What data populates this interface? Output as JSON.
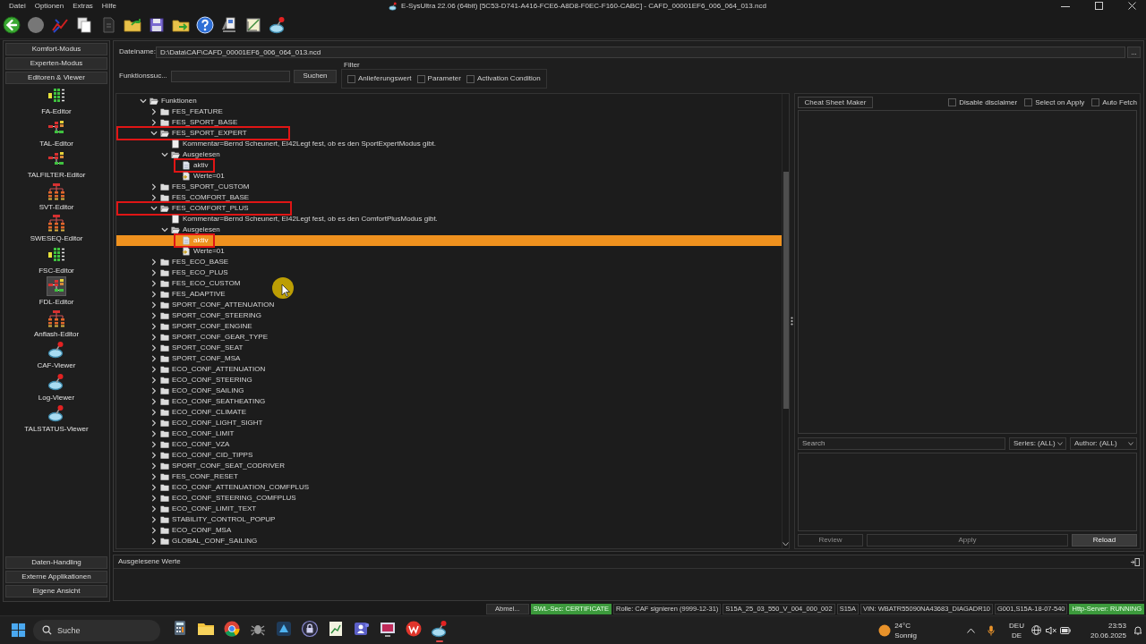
{
  "window": {
    "title": "E-SysUltra 22.06 (64bit) [5C53-D741-A416-FCE6-A8D8-F0EC-F160-CABC] - CAFD_00001EF6_006_064_013.ncd"
  },
  "menu": [
    "Datei",
    "Optionen",
    "Extras",
    "Hilfe"
  ],
  "sidebar": {
    "sections": [
      {
        "label": "Komfort-Modus"
      },
      {
        "label": "Experten-Modus"
      },
      {
        "label": "Editoren & Viewer",
        "items": [
          {
            "label": "FA-Editor",
            "kind": "list-editor",
            "selected": false
          },
          {
            "label": "TAL-Editor",
            "kind": "split-editor",
            "selected": false
          },
          {
            "label": "TALFILTER-Editor",
            "kind": "split-editor",
            "selected": false
          },
          {
            "label": "SVT-Editor",
            "kind": "tree-editor",
            "selected": false
          },
          {
            "label": "SWESEQ-Editor",
            "kind": "tree-editor",
            "selected": false
          },
          {
            "label": "FSC-Editor",
            "kind": "list-editor",
            "selected": false
          },
          {
            "label": "FDL-Editor",
            "kind": "split-editor",
            "selected": true
          },
          {
            "label": "Anflash-Editor",
            "kind": "tree-editor",
            "selected": false
          },
          {
            "label": "CAF-Viewer",
            "kind": "viewer",
            "selected": false
          },
          {
            "label": "Log-Viewer",
            "kind": "viewer",
            "selected": false
          },
          {
            "label": "TALSTATUS-Viewer",
            "kind": "viewer",
            "selected": false
          }
        ]
      },
      {
        "label": "Daten-Handling"
      },
      {
        "label": "Externe Applikationen"
      },
      {
        "label": "Eigene Ansicht"
      }
    ]
  },
  "file": {
    "label": "Dateiname:",
    "value": "D:\\Data\\CAF\\CAFD_00001EF6_006_064_013.ncd",
    "browse_button": "..."
  },
  "function_search": {
    "label": "Funktionssuc...",
    "button": "Suchen",
    "filter": {
      "title": "Filter",
      "options": [
        {
          "label": "Anlieferungswert",
          "checked": false
        },
        {
          "label": "Parameter",
          "checked": false
        },
        {
          "label": "Activation Condition",
          "checked": false
        }
      ]
    }
  },
  "tree": {
    "root": {
      "label": "Funktionen",
      "kind": "folder",
      "expanded": true,
      "highlighted": false,
      "selected": false,
      "children": [
        {
          "label": "FES_FEATURE",
          "kind": "folder",
          "expanded": false,
          "highlighted": false,
          "selected": false
        },
        {
          "label": "FES_SPORT_BASE",
          "kind": "folder",
          "expanded": false,
          "highlighted": false,
          "selected": false
        },
        {
          "label": "FES_SPORT_EXPERT",
          "kind": "folder",
          "expanded": true,
          "highlighted": true,
          "selected": false,
          "children": [
            {
              "label": "Kommentar=Bernd Scheunert, EI42Legt fest, ob es den SportExpertModus gibt.",
              "kind": "note",
              "highlighted": false,
              "selected": false
            },
            {
              "label": "Ausgelesen",
              "kind": "folder",
              "expanded": true,
              "highlighted": false,
              "selected": false,
              "children": [
                {
                  "label": "aktiv",
                  "kind": "entry",
                  "highlighted": true,
                  "selected": false
                },
                {
                  "label": "Werte=01",
                  "kind": "value",
                  "highlighted": false,
                  "selected": false
                }
              ]
            }
          ]
        },
        {
          "label": "FES_SPORT_CUSTOM",
          "kind": "folder",
          "expanded": false,
          "highlighted": false,
          "selected": false
        },
        {
          "label": "FES_COMFORT_BASE",
          "kind": "folder",
          "expanded": false,
          "highlighted": false,
          "selected": false
        },
        {
          "label": "FES_COMFORT_PLUS",
          "kind": "folder",
          "expanded": true,
          "highlighted": true,
          "selected": false,
          "children": [
            {
              "label": "Kommentar=Bernd Scheunert, EI42Legt fest, ob es den ComfortPlusModus gibt.",
              "kind": "note",
              "highlighted": false,
              "selected": false
            },
            {
              "label": "Ausgelesen",
              "kind": "folder",
              "expanded": true,
              "highlighted": false,
              "selected": false,
              "children": [
                {
                  "label": "aktiv",
                  "kind": "entry",
                  "highlighted": true,
                  "selected": true
                },
                {
                  "label": "Werte=01",
                  "kind": "value",
                  "highlighted": false,
                  "selected": false
                }
              ]
            }
          ]
        },
        {
          "label": "FES_ECO_BASE",
          "kind": "folder",
          "expanded": false,
          "highlighted": false,
          "selected": false
        },
        {
          "label": "FES_ECO_PLUS",
          "kind": "folder",
          "expanded": false,
          "highlighted": false,
          "selected": false
        },
        {
          "label": "FES_ECO_CUSTOM",
          "kind": "folder",
          "expanded": false,
          "highlighted": false,
          "selected": false
        },
        {
          "label": "FES_ADAPTIVE",
          "kind": "folder",
          "expanded": false,
          "highlighted": false,
          "selected": false
        },
        {
          "label": "SPORT_CONF_ATTENUATION",
          "kind": "folder",
          "expanded": false,
          "highlighted": false,
          "selected": false
        },
        {
          "label": "SPORT_CONF_STEERING",
          "kind": "folder",
          "expanded": false,
          "highlighted": false,
          "selected": false
        },
        {
          "label": "SPORT_CONF_ENGINE",
          "kind": "folder",
          "expanded": false,
          "highlighted": false,
          "selected": false
        },
        {
          "label": "SPORT_CONF_GEAR_TYPE",
          "kind": "folder",
          "expanded": false,
          "highlighted": false,
          "selected": false
        },
        {
          "label": "SPORT_CONF_SEAT",
          "kind": "folder",
          "expanded": false,
          "highlighted": false,
          "selected": false
        },
        {
          "label": "SPORT_CONF_MSA",
          "kind": "folder",
          "expanded": false,
          "highlighted": false,
          "selected": false
        },
        {
          "label": "ECO_CONF_ATTENUATION",
          "kind": "folder",
          "expanded": false,
          "highlighted": false,
          "selected": false
        },
        {
          "label": "ECO_CONF_STEERING",
          "kind": "folder",
          "expanded": false,
          "highlighted": false,
          "selected": false
        },
        {
          "label": "ECO_CONF_SAILING",
          "kind": "folder",
          "expanded": false,
          "highlighted": false,
          "selected": false
        },
        {
          "label": "ECO_CONF_SEATHEATING",
          "kind": "folder",
          "expanded": false,
          "highlighted": false,
          "selected": false
        },
        {
          "label": "ECO_CONF_CLIMATE",
          "kind": "folder",
          "expanded": false,
          "highlighted": false,
          "selected": false
        },
        {
          "label": "ECO_CONF_LIGHT_SIGHT",
          "kind": "folder",
          "expanded": false,
          "highlighted": false,
          "selected": false
        },
        {
          "label": "ECO_CONF_LIMIT",
          "kind": "folder",
          "expanded": false,
          "highlighted": false,
          "selected": false
        },
        {
          "label": "ECO_CONF_VZA",
          "kind": "folder",
          "expanded": false,
          "highlighted": false,
          "selected": false
        },
        {
          "label": "ECO_CONF_CID_TIPPS",
          "kind": "folder",
          "expanded": false,
          "highlighted": false,
          "selected": false
        },
        {
          "label": "SPORT_CONF_SEAT_CODRIVER",
          "kind": "folder",
          "expanded": false,
          "highlighted": false,
          "selected": false
        },
        {
          "label": "FES_CONF_RESET",
          "kind": "folder",
          "expanded": false,
          "highlighted": false,
          "selected": false
        },
        {
          "label": "ECO_CONF_ATTENUATION_COMFPLUS",
          "kind": "folder",
          "expanded": false,
          "highlighted": false,
          "selected": false
        },
        {
          "label": "ECO_CONF_STEERING_COMFPLUS",
          "kind": "folder",
          "expanded": false,
          "highlighted": false,
          "selected": false
        },
        {
          "label": "ECO_CONF_LIMIT_TEXT",
          "kind": "folder",
          "expanded": false,
          "highlighted": false,
          "selected": false
        },
        {
          "label": "STABILITY_CONTROL_POPUP",
          "kind": "folder",
          "expanded": false,
          "highlighted": false,
          "selected": false
        },
        {
          "label": "ECO_CONF_MSA",
          "kind": "folder",
          "expanded": false,
          "highlighted": false,
          "selected": false
        },
        {
          "label": "GLOBAL_CONF_SAILING",
          "kind": "folder",
          "expanded": false,
          "highlighted": false,
          "selected": false
        }
      ]
    }
  },
  "cheat_sheet": {
    "header_button": "Cheat Sheet Maker",
    "options": [
      {
        "label": "Disable disclaimer",
        "checked": false
      },
      {
        "label": "Select on Apply",
        "checked": false
      },
      {
        "label": "Auto Fetch",
        "checked": false
      }
    ],
    "search": {
      "placeholder": "Search"
    },
    "filters": [
      {
        "label": "Series: (ALL)"
      },
      {
        "label": "Author: (ALL)"
      }
    ],
    "buttons": [
      {
        "label": "Review",
        "disabled": true
      },
      {
        "label": "Apply",
        "disabled": true
      },
      {
        "label": "Reload",
        "disabled": false
      }
    ]
  },
  "output_panel": {
    "title": "Ausgelesene Werte"
  },
  "status_bar": [
    {
      "text": "Abmel...",
      "kind": "button"
    },
    {
      "text": "SWL-Sec: CERTIFICATE",
      "kind": "ok"
    },
    {
      "text": "Rolle: CAF signieren (9999-12-31)",
      "kind": "field"
    },
    {
      "text": "S15A_25_03_550_V_004_000_002",
      "kind": "field"
    },
    {
      "text": "S15A",
      "kind": "field"
    },
    {
      "text": "VIN: WBATR55090NA43683_DIAGADR10",
      "kind": "field"
    },
    {
      "text": "G001,S15A-18-07-540",
      "kind": "field"
    },
    {
      "text": "Http-Server: RUNNING",
      "kind": "ok"
    }
  ],
  "taskbar": {
    "search": {
      "placeholder": "Suche"
    },
    "apps": [
      {
        "kind": "calculator",
        "active": false
      },
      {
        "kind": "files",
        "active": false
      },
      {
        "kind": "browser",
        "active": false
      },
      {
        "kind": "bug",
        "active": false
      },
      {
        "kind": "triangle",
        "active": false
      },
      {
        "kind": "lock",
        "active": false
      },
      {
        "kind": "chart",
        "active": false
      },
      {
        "kind": "people",
        "active": false
      },
      {
        "kind": "screen",
        "active": false
      },
      {
        "kind": "circle",
        "active": false
      },
      {
        "kind": "lens",
        "active": true
      }
    ],
    "weather": {
      "temperature": "24°C",
      "condition": "Sonnig"
    },
    "language": {
      "line_1": "DEU",
      "line_2": "DE"
    },
    "time": "23:53",
    "date": "20.06.2025"
  }
}
